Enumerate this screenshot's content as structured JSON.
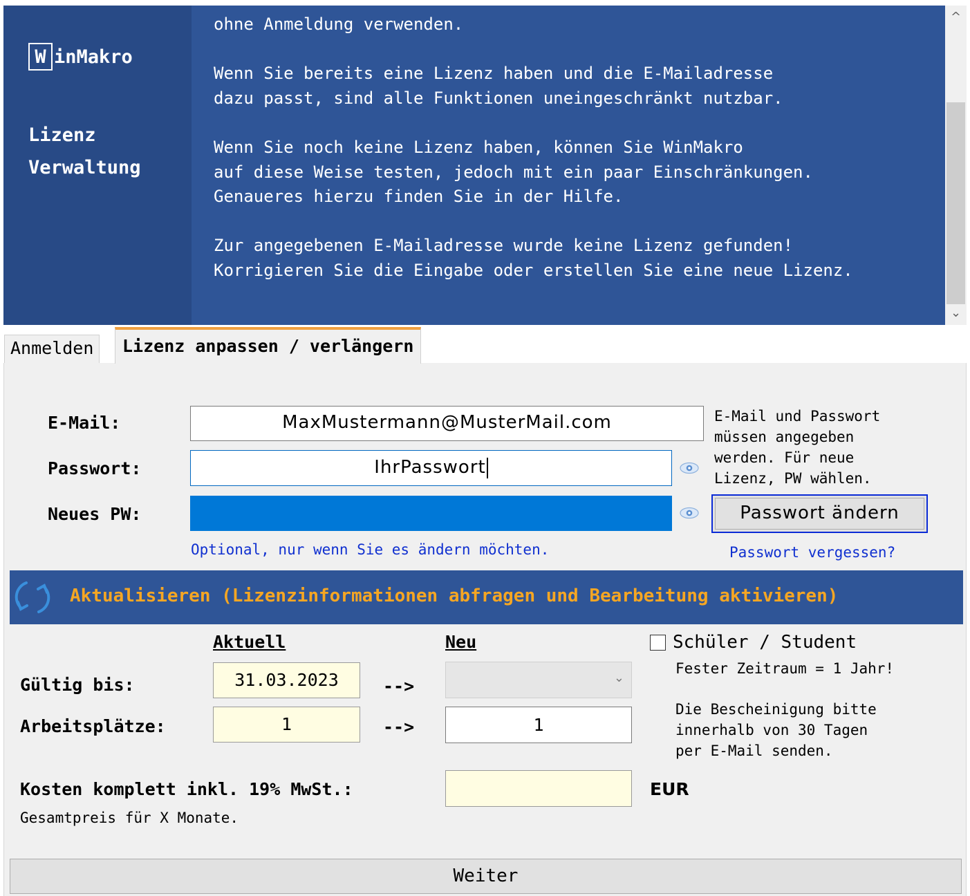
{
  "banner": {
    "logo_letter": "W",
    "logo_rest": "inMakro",
    "title_line1": "Lizenz",
    "title_line2": "Verwaltung",
    "message": "ohne Anmeldung verwenden.\n\nWenn Sie bereits eine Lizenz haben und die E-Mailadresse\ndazu passt, sind alle Funktionen uneingeschränkt nutzbar.\n\nWenn Sie noch keine Lizenz haben, können Sie WinMakro\nauf diese Weise testen, jedoch mit ein paar Einschränkungen.\nGenaueres hierzu finden Sie in der Hilfe.\n\nZur angegebenen E-Mailadresse wurde keine Lizenz gefunden!\nKorrigieren Sie die Eingabe oder erstellen Sie eine neue Lizenz.",
    "colors": {
      "background": "#2f5597",
      "sidebar": "#284a86",
      "text": "#ffffff"
    }
  },
  "scrollbar": {
    "up_icon": "chevron-up-icon",
    "down_icon": "chevron-down-icon",
    "up_glyph": "^",
    "down_glyph": "⌄"
  },
  "tabs": [
    {
      "label": "Anmelden",
      "active": false
    },
    {
      "label": "Lizenz anpassen / verlängern",
      "active": true
    }
  ],
  "form": {
    "email_label": "E-Mail:",
    "email_value": "MaxMustermann@MusterMail.com",
    "password_label": "Passwort:",
    "password_value": "IhrPasswort",
    "new_password_label": "Neues PW:",
    "new_password_value": "",
    "show_password_icon": "eye-icon",
    "hint": "E-Mail und Passwort\nmüssen angegeben\nwerden. Für neue\nLizenz, PW wählen.",
    "change_password_button": "Passwort ändern",
    "optional_hint": "Optional, nur wenn Sie es ändern möchten.",
    "forgot_password_link": "Passwort vergessen?"
  },
  "refresh": {
    "icon": "refresh-icon",
    "label": "Aktualisieren (Lizenzinformationen abfragen und Bearbeitung aktivieren)",
    "colors": {
      "background": "#2f5597",
      "text": "#f5a623"
    }
  },
  "license": {
    "current_header": "Aktuell",
    "new_header": "Neu",
    "valid_until_label": "Gültig bis:",
    "valid_until_current": "31.03.2023",
    "valid_until_new": "",
    "seats_label": "Arbeitsplätze:",
    "seats_current": "1",
    "seats_new": "1",
    "arrow": "-->",
    "student_checkbox_label": "Schüler / Student",
    "student_checked": false,
    "student_note1": "Fester Zeitraum = 1 Jahr!",
    "student_note2": "Die Bescheinigung bitte\ninnerhalb von 30 Tagen\nper E-Mail senden.",
    "cost_label": "Kosten komplett inkl. 19% MwSt.:",
    "cost_value": "",
    "cost_unit": "EUR",
    "cost_note": "Gesamtpreis für X Monate."
  },
  "footer": {
    "next_button": "Weiter"
  }
}
